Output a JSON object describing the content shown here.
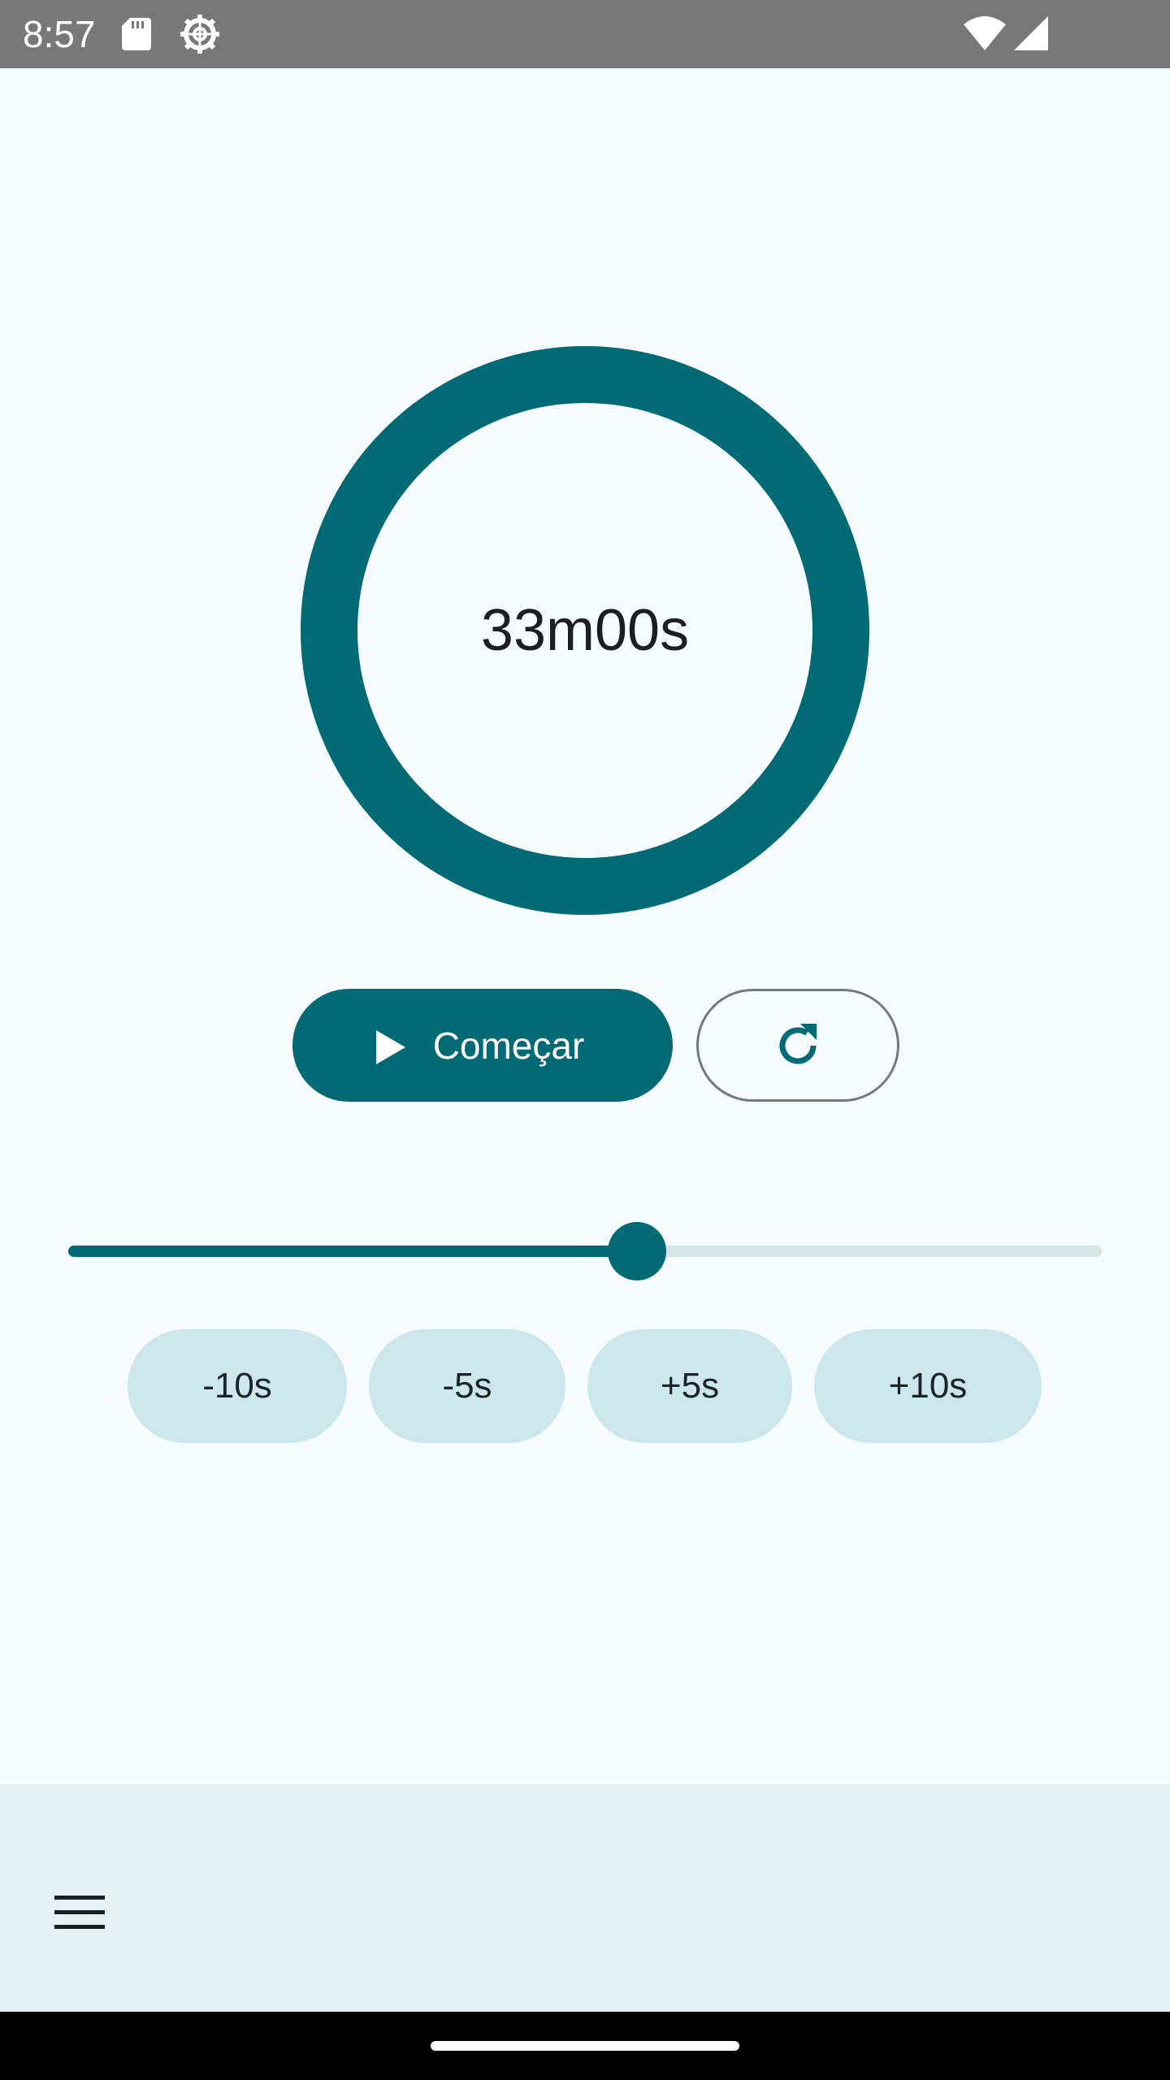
{
  "status_bar": {
    "time": "8:57",
    "icons": [
      "sd-card-icon",
      "settings-gear-icon",
      "wifi-icon",
      "cell-signal-icon"
    ]
  },
  "timer": {
    "display": "33m00s",
    "progress": 1.0
  },
  "controls": {
    "start_label": "Começar",
    "start_icon": "play-icon",
    "reset_icon": "refresh-icon"
  },
  "slider": {
    "value_fraction": 0.55
  },
  "adjust_buttons": {
    "minus10": "-10s",
    "minus5": "-5s",
    "plus5": "+5s",
    "plus10": "+10s"
  },
  "bottom_bar": {
    "menu_icon": "hamburger-menu-icon"
  },
  "colors": {
    "accent": "#016a74",
    "background": "#f6fbfd",
    "chip": "#cce7eb",
    "bottom_bar": "#e5f1f3"
  }
}
